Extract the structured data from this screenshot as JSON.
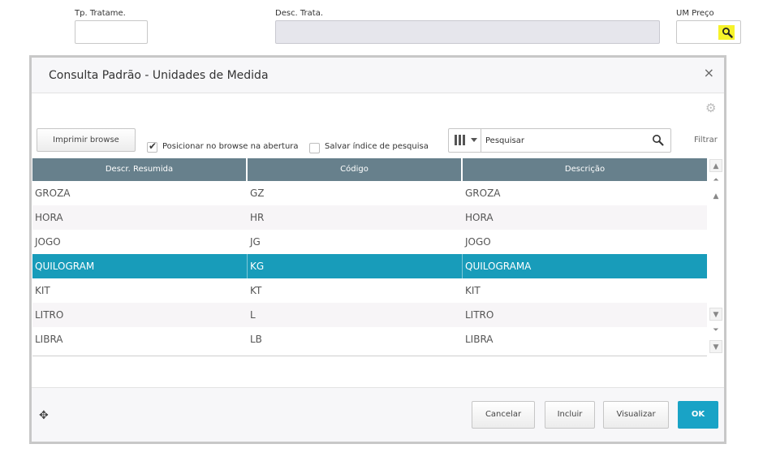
{
  "form": {
    "tp_tratame_label": "Tp. Tratame.",
    "tp_tratame_value": "",
    "desc_trata_label": "Desc. Trata.",
    "desc_trata_value": "",
    "um_preco_label": "UM Preço",
    "um_preco_value": ""
  },
  "dialog": {
    "title": "Consulta Padrão - Unidades de Medida",
    "close_label": "×",
    "print_button": "Imprimir browse",
    "check_position": {
      "label": "Posicionar no browse na abertura",
      "checked": true
    },
    "check_save": {
      "label": "Salvar índice de pesquisa",
      "checked": false
    },
    "search_placeholder": "Pesquisar",
    "search_value": "",
    "filter_label": "Filtrar",
    "columns": [
      "Descr. Resumida",
      "Código",
      "Descrição"
    ],
    "rows": [
      {
        "desc": "GROZA",
        "code": "GZ",
        "full": "GROZA"
      },
      {
        "desc": "HORA",
        "code": "HR",
        "full": "HORA"
      },
      {
        "desc": "JOGO",
        "code": "JG",
        "full": "JOGO"
      },
      {
        "desc": "QUILOGRAM",
        "code": "KG",
        "full": "QUILOGRAMA"
      },
      {
        "desc": "KIT",
        "code": "KT",
        "full": "KIT"
      },
      {
        "desc": "LITRO",
        "code": "L",
        "full": "LITRO"
      },
      {
        "desc": "LIBRA",
        "code": "LB",
        "full": "LIBRA"
      }
    ],
    "selected_row": 3,
    "buttons": {
      "cancel": "Cancelar",
      "include": "Incluir",
      "view": "Visualizar",
      "ok": "OK"
    }
  },
  "icons": {
    "lookup": "magnifier-icon",
    "gear": "gear-icon",
    "columns": "columns-icon",
    "move": "move-icon",
    "highlight_color": "#f6f22a",
    "accent_color": "#189cba",
    "header_color": "#67808c"
  }
}
